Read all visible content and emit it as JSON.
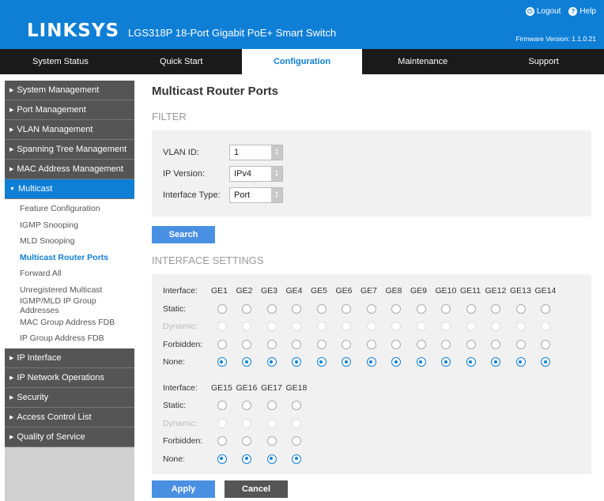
{
  "header": {
    "brand": "LINKSYS",
    "product": "LGS318P 18-Port Gigabit PoE+ Smart Switch",
    "logout": "Logout",
    "help": "Help",
    "firmware": "Firmware Version: 1.1.0.21"
  },
  "nav": {
    "tabs": [
      {
        "label": "System Status"
      },
      {
        "label": "Quick Start"
      },
      {
        "label": "Configuration"
      },
      {
        "label": "Maintenance"
      },
      {
        "label": "Support"
      }
    ],
    "active": "Configuration"
  },
  "sidebar": {
    "items": [
      {
        "label": "System Management"
      },
      {
        "label": "Port Management"
      },
      {
        "label": "VLAN Management"
      },
      {
        "label": "Spanning Tree Management"
      },
      {
        "label": "MAC Address Management"
      },
      {
        "label": "Multicast"
      },
      {
        "label": "IP Interface"
      },
      {
        "label": "IP Network Operations"
      },
      {
        "label": "Security"
      },
      {
        "label": "Access Control List"
      },
      {
        "label": "Quality of Service"
      }
    ],
    "multicast_sub": [
      {
        "label": "Feature Configuration"
      },
      {
        "label": "IGMP Snooping"
      },
      {
        "label": "MLD Snooping"
      },
      {
        "label": "Multicast Router Ports"
      },
      {
        "label": "Forward All"
      },
      {
        "label": "Unregistered Multicast"
      },
      {
        "label": "IGMP/MLD IP Group Addresses"
      },
      {
        "label": "MAC Group Address FDB"
      },
      {
        "label": "IP Group Address FDB"
      }
    ]
  },
  "main": {
    "title": "Multicast Router Ports",
    "filter_title": "FILTER",
    "vlan_id_label": "VLAN ID:",
    "vlan_id_value": "1",
    "ip_version_label": "IP Version:",
    "ip_version_value": "IPv4",
    "interface_type_label": "Interface Type:",
    "interface_type_value": "Port",
    "search_label": "Search",
    "interface_settings_title": "INTERFACE SETTINGS",
    "row_labels": {
      "interface": "Interface:",
      "static": "Static:",
      "dynamic": "Dynamic:",
      "forbidden": "Forbidden:",
      "none": "None:"
    },
    "ports_group1": [
      "GE1",
      "GE2",
      "GE3",
      "GE4",
      "GE5",
      "GE6",
      "GE7",
      "GE8",
      "GE9",
      "GE10",
      "GE11",
      "GE12",
      "GE13",
      "GE14"
    ],
    "ports_group2": [
      "GE15",
      "GE16",
      "GE17",
      "GE18"
    ],
    "selected_mode": "None",
    "apply_label": "Apply",
    "cancel_label": "Cancel"
  },
  "colors": {
    "brand_blue": "#0f7fd6",
    "nav_dark": "#1a1a1a",
    "sidebar_item": "#555555",
    "button_blue": "#4a90e2"
  }
}
